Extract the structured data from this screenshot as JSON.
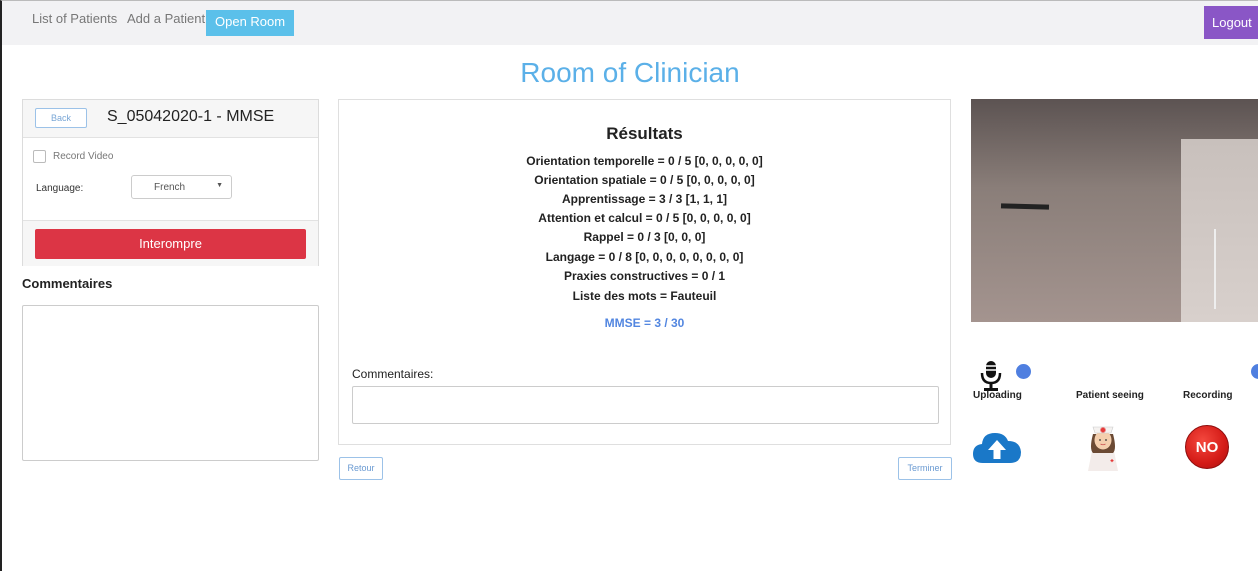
{
  "nav": {
    "items": [
      "List of Patients",
      "Add a Patient"
    ],
    "active": "Open Room",
    "logout": "Logout"
  },
  "page_title": "Room of Clinician",
  "left_panel": {
    "back_label": "Back",
    "session_title": "S_05042020-1 - MMSE",
    "record_video_label": "Record Video",
    "record_video_checked": false,
    "language_label": "Language:",
    "language_value": "French",
    "stop_label": "Interompre",
    "comments_label": "Commentaires",
    "comments_value": ""
  },
  "results": {
    "title": "Résultats",
    "lines": [
      "Orientation temporelle = 0 / 5 [0, 0, 0, 0, 0]",
      "Orientation spatiale = 0 / 5 [0, 0, 0, 0, 0]",
      "Apprentissage = 3 / 3 [1, 1, 1]",
      "Attention et calcul = 0 / 5 [0, 0, 0, 0, 0]",
      "Rappel = 0 / 3 [0, 0, 0]",
      "Langage = 0 / 8 [0, 0, 0, 0, 0, 0, 0, 0]",
      "Praxies constructives = 0 / 1",
      "Liste des mots = Fauteuil"
    ],
    "mmse_total": "MMSE = 3 / 30",
    "comments_label": "Commentaires:",
    "comments_value": "",
    "back_label": "Retour",
    "finish_label": "Terminer"
  },
  "status": {
    "uploading_label": "Uploading",
    "patient_seeing_label": "Patient seeing",
    "recording_label": "Recording",
    "recording_badge": "NO",
    "indicator_color": "#4f7fe0"
  },
  "icons": {
    "mic": "microphone-icon",
    "cloud": "cloud-upload-icon",
    "nurse": "nurse-icon",
    "recording": "no-badge-icon"
  },
  "colors": {
    "nav_active": "#5bc0ea",
    "logout": "#8a56c6",
    "danger": "#dc3545",
    "title": "#5bb0e8",
    "mmse": "#5286e0"
  }
}
